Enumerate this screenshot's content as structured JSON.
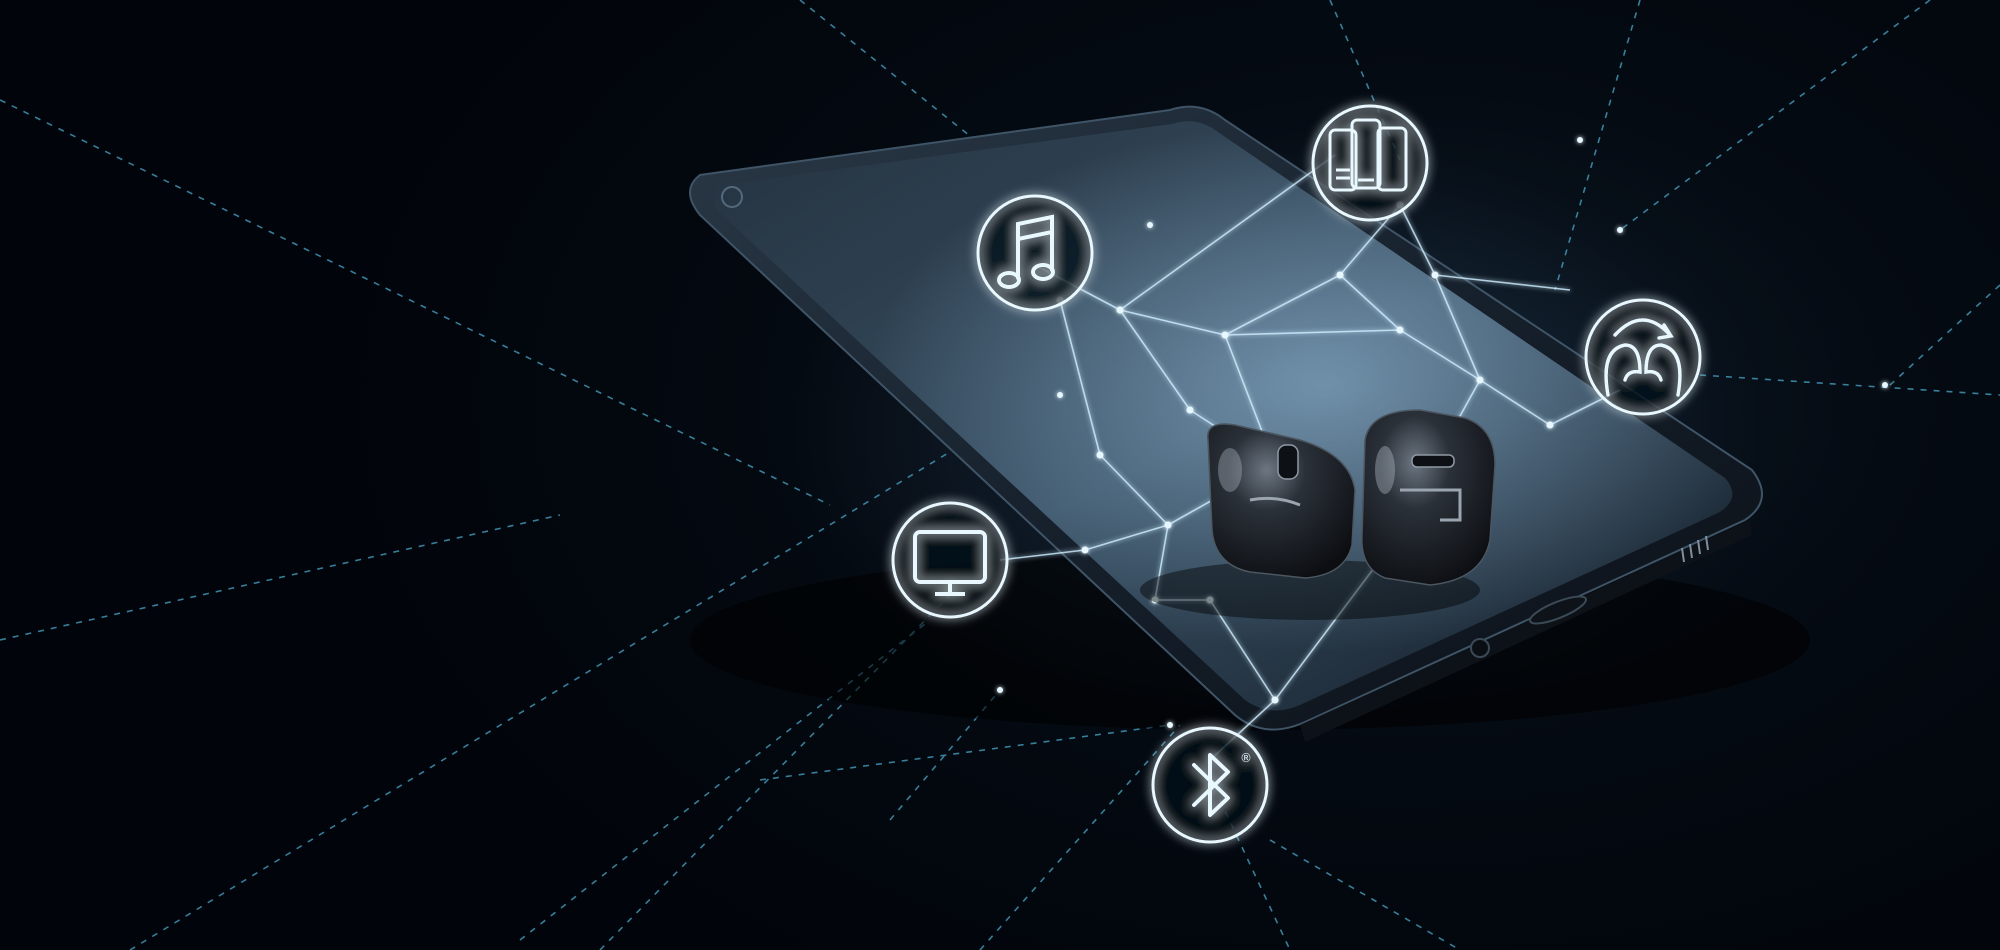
{
  "scene": {
    "description_free": true,
    "colors": {
      "background": "#02060c",
      "network_line": "#5fb8d6",
      "icon_glow": "#bfe8ff",
      "phone_body": "#1b2632",
      "earbud": "#1c1f24"
    }
  },
  "icons": [
    {
      "name": "music-note-icon"
    },
    {
      "name": "devices-icon"
    },
    {
      "name": "head-arrow-icon"
    },
    {
      "name": "television-icon"
    },
    {
      "name": "bluetooth-icon",
      "mark": "®"
    }
  ]
}
